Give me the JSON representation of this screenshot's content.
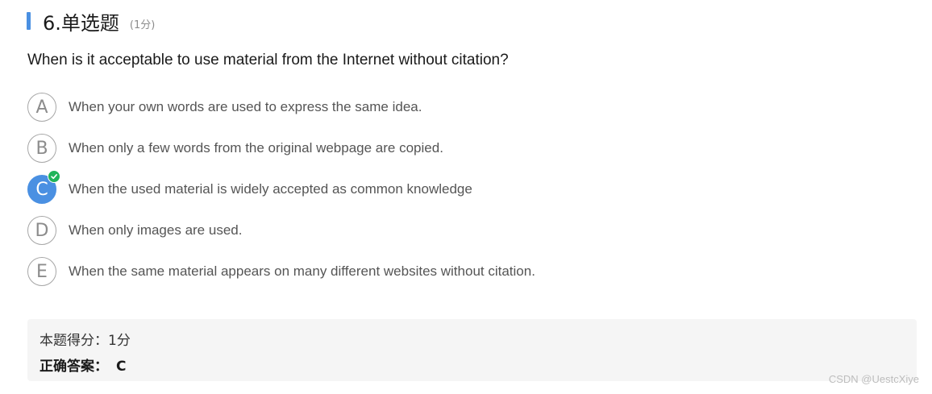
{
  "header": {
    "title": "6.单选题",
    "score": "(1分)"
  },
  "question": {
    "text": "When is it acceptable to use material from the Internet without citation?"
  },
  "options": [
    {
      "letter": "A",
      "text": "When your own words are used to express the same idea.",
      "selected": false
    },
    {
      "letter": "B",
      "text": "When only a few words from the original webpage are copied.",
      "selected": false
    },
    {
      "letter": "C",
      "text": "When the used material is widely accepted as common knowledge",
      "selected": true
    },
    {
      "letter": "D",
      "text": "When only images are used.",
      "selected": false
    },
    {
      "letter": "E",
      "text": "When the same material appears on many different websites without citation.",
      "selected": false
    }
  ],
  "result": {
    "score_text": "本题得分：1分",
    "answer_label": "正确答案：",
    "answer_value": "C"
  },
  "watermark": "CSDN @UestcXiye",
  "colors": {
    "accent": "#4a90e2",
    "correct": "#20b45a"
  },
  "icons": {
    "correct_badge": "check-circle-icon"
  }
}
